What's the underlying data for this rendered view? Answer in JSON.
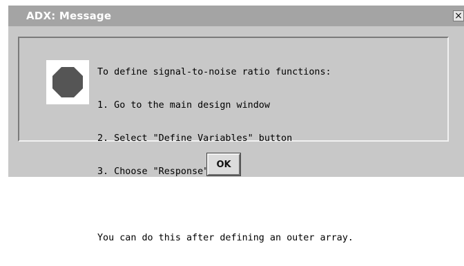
{
  "window": {
    "title": "ADX: Message",
    "close_label": "×"
  },
  "message": {
    "icon": "stop-octagon-icon",
    "lines": [
      "To define signal-to-noise ratio functions:",
      "1. Go to the main design window",
      "2. Select \"Define Variables\" button",
      "3. Choose \"Response\" tab"
    ],
    "note": "You can do this after defining an outer array."
  },
  "buttons": {
    "ok_label": "OK"
  }
}
